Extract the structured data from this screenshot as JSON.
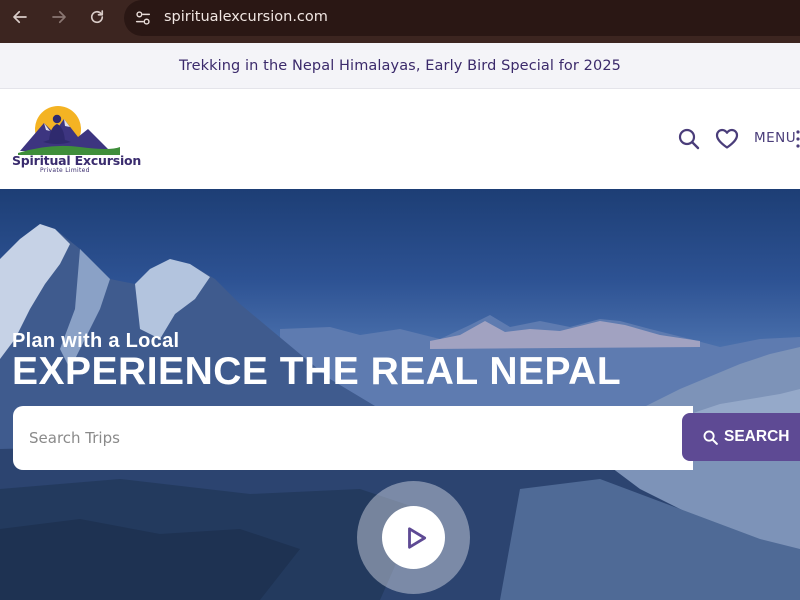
{
  "browser": {
    "url": "spiritualexcursion.com",
    "back_icon": "arrow-left-icon",
    "forward_icon": "arrow-right-icon",
    "reload_icon": "reload-icon",
    "site_info_icon": "tune-icon"
  },
  "announcement": {
    "text": "Trekking in the Nepal Himalayas, Early Bird Special for 2025"
  },
  "header": {
    "logo_name": "Spiritual Excursion",
    "logo_sub": "Private Limited",
    "search_icon": "search-icon",
    "wishlist_icon": "heart-icon",
    "menu_label": "MENU"
  },
  "hero": {
    "tagline": "Plan with a Local",
    "headline": "EXPERIENCE THE REAL NEPAL",
    "search_placeholder": "Search Trips",
    "search_button": "SEARCH",
    "play_icon": "play-icon"
  },
  "colors": {
    "brand_purple": "#5e4a94",
    "brand_dark": "#3a2c6e",
    "chrome_bg": "#3c2520"
  }
}
